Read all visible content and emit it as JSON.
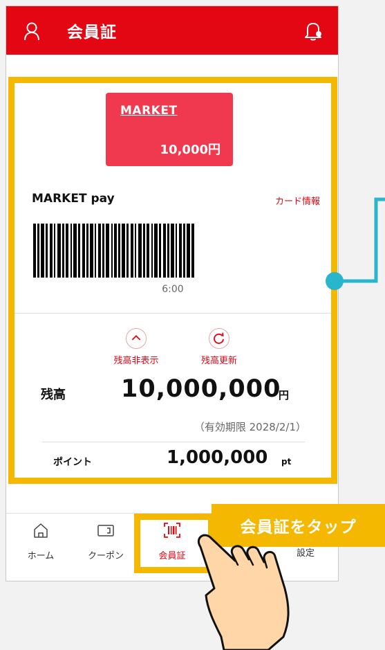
{
  "header": {
    "title": "会員証"
  },
  "card": {
    "mini_card_name": "MARKET",
    "mini_card_amount": "10,000円",
    "pay_label": "MARKET pay",
    "card_info_link": "カード情報",
    "timer": "6:00"
  },
  "actions": {
    "hide_balance": "残高非表示",
    "refresh_balance": "残高更新"
  },
  "balance": {
    "label": "残高",
    "value": "10,000,000",
    "unit": "円",
    "expiry": "（有効期限 2028/2/1）"
  },
  "points": {
    "label": "ポイント",
    "value": "1,000,000",
    "unit": "pt"
  },
  "nav": {
    "home": "ホーム",
    "coupon": "クーポン",
    "member_card": "会員証",
    "settings": "設定"
  },
  "callout": {
    "text": "会員証をタップ"
  },
  "colors": {
    "brand_red": "#e30613",
    "card_pink": "#f0384f",
    "highlight_yellow": "#f5b800",
    "connector_teal": "#29b6cc",
    "hand_skin": "#ffd6a8"
  },
  "icons": {
    "header_left": "user-icon",
    "header_right": "bell-icon",
    "hide": "chevron-up-icon",
    "refresh": "refresh-icon",
    "nav_home": "home-icon",
    "nav_coupon": "coupon-icon",
    "nav_card": "barcode-scan-icon"
  }
}
